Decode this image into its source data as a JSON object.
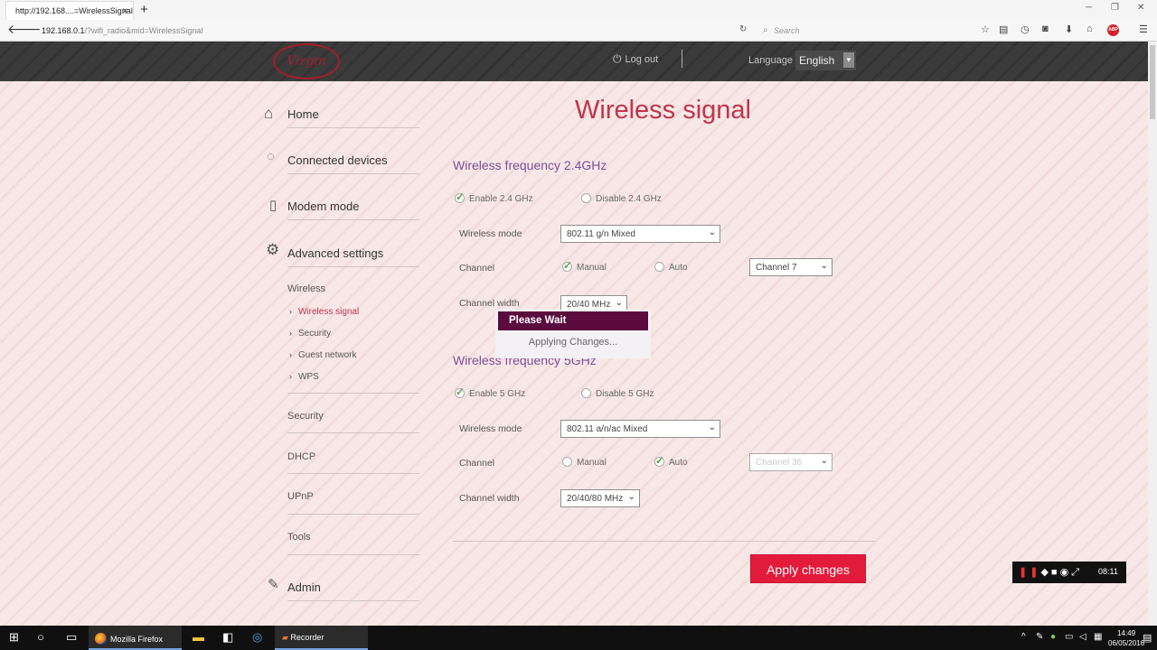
{
  "browser": {
    "tab_title": "http://192.168....=WirelessSignal",
    "tab_close": "×",
    "new_tab": "+",
    "url_host": "192.168.0.1",
    "url_path": "/?wifi_radio&mid=WirelessSignal",
    "search_placeholder": "Search",
    "window_controls": [
      "─",
      "❐",
      "✕"
    ]
  },
  "header": {
    "logo_text": "Virgin",
    "logout_label": "Log out",
    "language_label": "Language",
    "language_value": "English"
  },
  "sidebar": {
    "main_items": [
      {
        "label": "Home",
        "icon": "home-icon"
      },
      {
        "label": "Connected devices",
        "icon": "devices-icon"
      },
      {
        "label": "Modem mode",
        "icon": "modem-icon"
      },
      {
        "label": "Advanced settings",
        "icon": "gear-icon"
      }
    ],
    "wireless_label": "Wireless",
    "wireless_subitems": [
      "Wireless signal",
      "Security",
      "Guest network",
      "WPS"
    ],
    "other_items": [
      "Security",
      "DHCP",
      "UPnP",
      "Tools"
    ],
    "admin_label": "Admin"
  },
  "main": {
    "title": "Wireless signal",
    "band24": {
      "section_title": "Wireless frequency 2.4GHz",
      "enable_label": "Enable 2.4 GHz",
      "disable_label": "Disable 2.4 GHz",
      "mode_label": "Wireless mode",
      "mode_value": "802.11 g/n Mixed",
      "channel_label": "Channel",
      "manual_label": "Manual",
      "auto_label": "Auto",
      "channel_value": "Channel 7",
      "width_label": "Channel width",
      "width_value": "20/40 MHz"
    },
    "band5": {
      "section_title": "Wireless frequency 5GHz",
      "enable_label": "Enable 5 GHz",
      "disable_label": "Disable 5 GHz",
      "mode_label": "Wireless mode",
      "mode_value": "802.11 a/n/ac Mixed",
      "channel_label": "Channel",
      "manual_label": "Manual",
      "auto_label": "Auto",
      "channel_value": "Channel 36",
      "width_label": "Channel width",
      "width_value": "20/40/80 MHz"
    },
    "apply_label": "Apply changes"
  },
  "dialog": {
    "title": "Please Wait",
    "message": "Applying Changes..."
  },
  "recorder": {
    "time": "08:11"
  },
  "taskbar": {
    "firefox_label": "Mozilla Firefox",
    "recorder_label": "Recorder",
    "time": "14:49",
    "date": "06/05/2016"
  },
  "colors": {
    "accent": "#c1344b",
    "section": "#7a4f9a",
    "button": "#e31b3b",
    "dialog_header": "#5b0b3e"
  }
}
